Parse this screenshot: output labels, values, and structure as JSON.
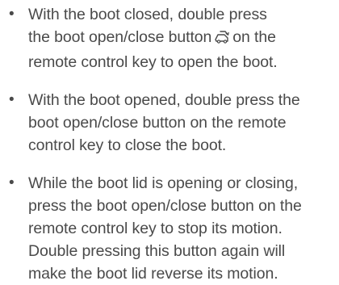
{
  "instructions": [
    {
      "bullet": "•",
      "lines": [
        {
          "before": "With the boot closed, double press"
        },
        {
          "before": "the boot open/close button",
          "icon": "boot-open-close-icon",
          "after": "on the"
        },
        {
          "before": "remote control key to open the boot."
        }
      ]
    },
    {
      "bullet": "•",
      "lines": [
        {
          "before": "With the boot opened, double press the"
        },
        {
          "before": "boot open/close button on the remote"
        },
        {
          "before": "control key to close the boot."
        }
      ]
    },
    {
      "bullet": "•",
      "lines": [
        {
          "before": "While the boot lid is opening or closing,"
        },
        {
          "before": "press the boot open/close button on the"
        },
        {
          "before": "remote control key to stop its motion."
        },
        {
          "before": "Double pressing this button again will"
        },
        {
          "before": "make the boot lid reverse its motion."
        }
      ]
    }
  ]
}
